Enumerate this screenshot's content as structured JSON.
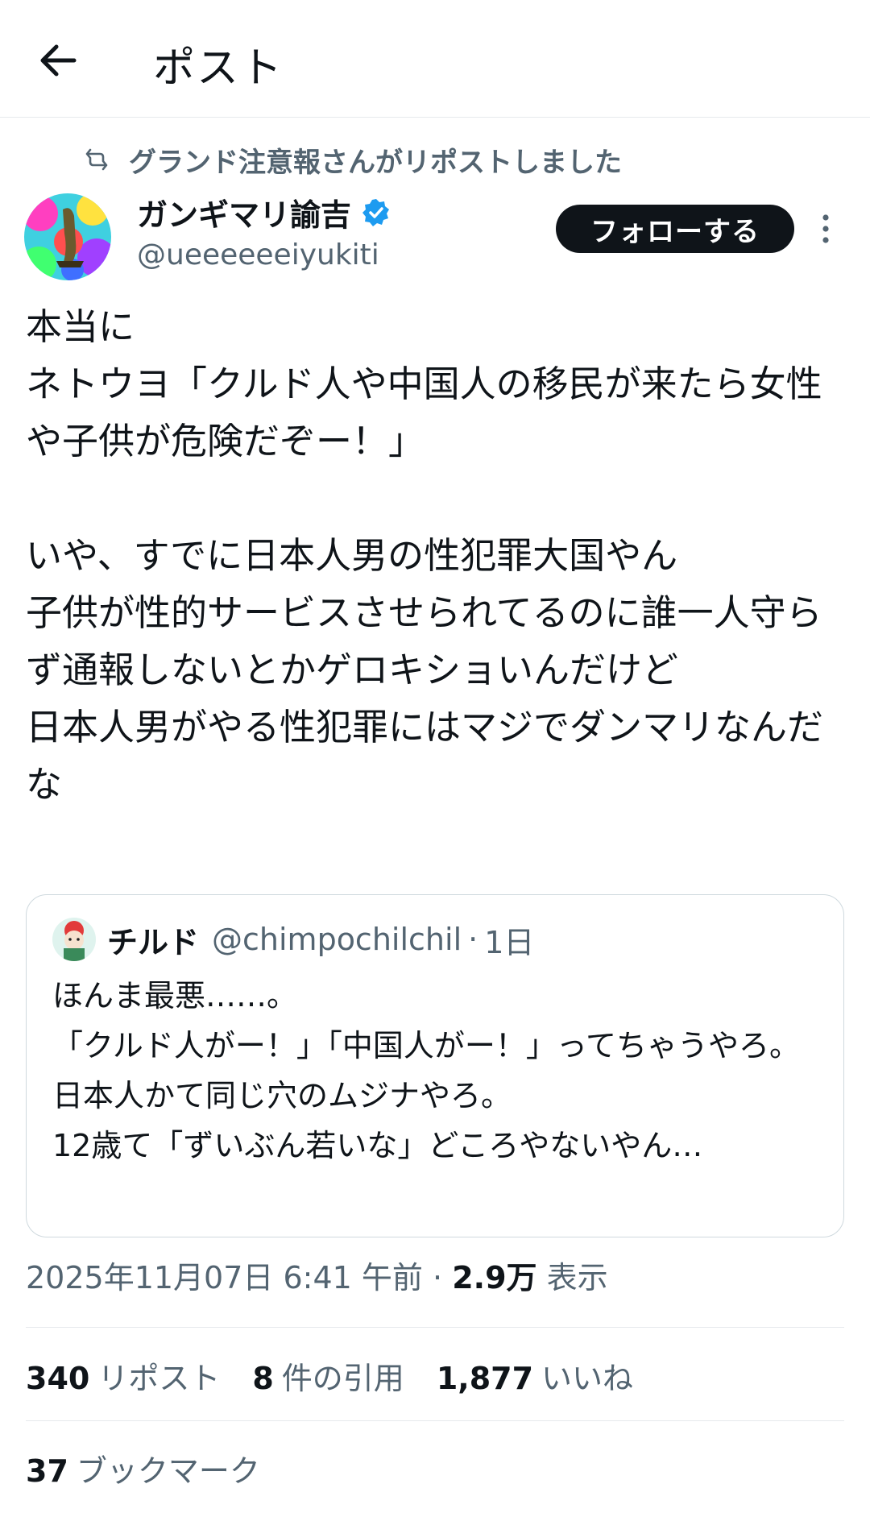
{
  "header": {
    "title": "ポスト"
  },
  "repost": {
    "text": "グランド注意報さんがリポストしました"
  },
  "author": {
    "name": "ガンギマリ諭吉",
    "handle": "@ueeeeeeiyukiti"
  },
  "follow": {
    "label": "フォローする"
  },
  "post": {
    "text": "本当に\nネトウヨ「クルド人や中国人の移民が来たら女性や子供が危険だぞー！」\n\nいや、すでに日本人男の性犯罪大国やん\n子供が性的サービスさせられてるのに誰一人守らず通報しないとかゲロキショいんだけど\n日本人男がやる性犯罪にはマジでダンマリなんだな"
  },
  "quote": {
    "name": "チルド",
    "handle": "@chimpochilchil",
    "separator": "·",
    "time": "1日",
    "text": "ほんま最悪……。\n「クルド人がー！」「中国人がー！」ってちゃうやろ。\n日本人かて同じ穴のムジナやろ。\n12歳て「ずいぶん若いな」どころやないやん…"
  },
  "meta": {
    "datetime": "2025年11月07日 6:41 午前",
    "separator": "·",
    "views": "2.9万",
    "views_label": "表示"
  },
  "stats": {
    "reposts": "340",
    "reposts_label": "リポスト",
    "quotes": "8",
    "quotes_label": "件の引用",
    "likes": "1,877",
    "likes_label": "いいね",
    "bookmarks": "37",
    "bookmarks_label": "ブックマーク"
  },
  "colors": {
    "text": "#0f1419",
    "secondary": "#536471",
    "verified": "#1d9bf0",
    "border": "#cfd9de"
  },
  "icons": [
    "back-arrow-icon",
    "repost-icon",
    "verified-badge-icon",
    "more-options-icon"
  ]
}
